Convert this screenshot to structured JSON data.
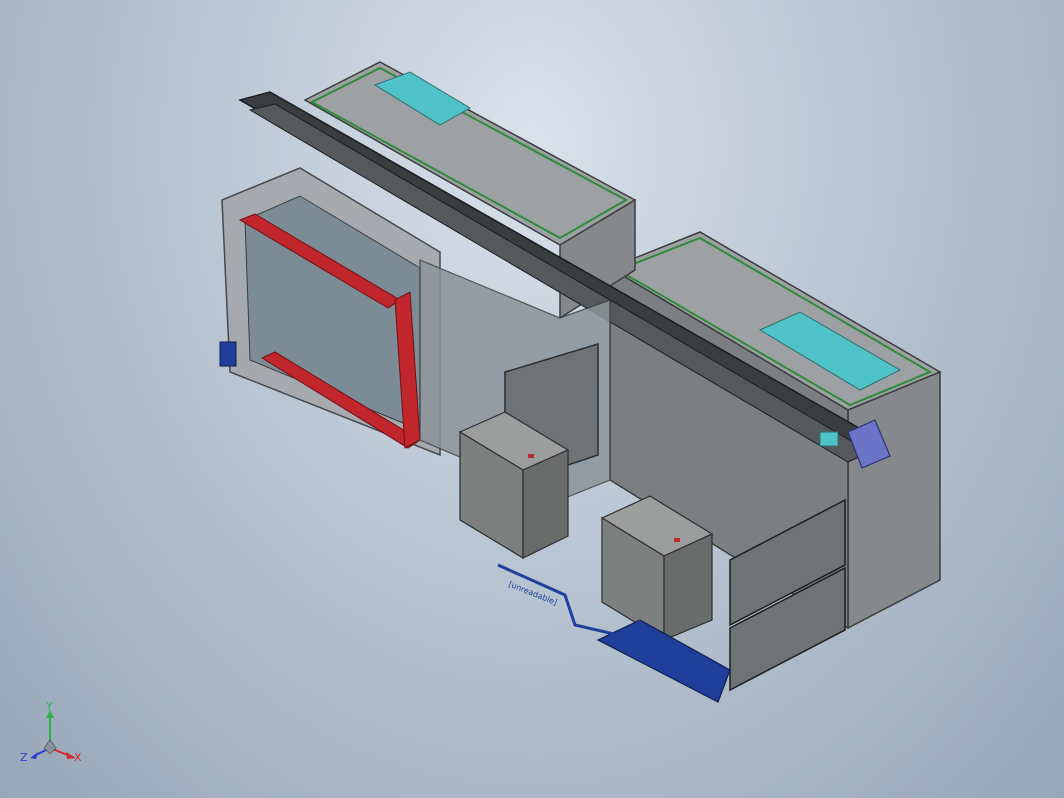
{
  "viewport": {
    "background_top": "#d9e2ec",
    "background_bottom": "#97a7b8"
  },
  "model": {
    "frame_color": "#a0a3a6",
    "panel_color": "#8f9396",
    "trim_green": "#2f8a3a",
    "rail_red": "#c0262b",
    "base_blue": "#1f3f9a",
    "accent_cyan": "#4fc3c7",
    "box_color": "#7e7f7f",
    "floor_label": "[unreadable]"
  },
  "triad": {
    "x_label": "X",
    "y_label": "Y",
    "z_label": "Z",
    "x_color": "#d22a2a",
    "y_color": "#2fb24a",
    "z_color": "#2a3fd2"
  }
}
